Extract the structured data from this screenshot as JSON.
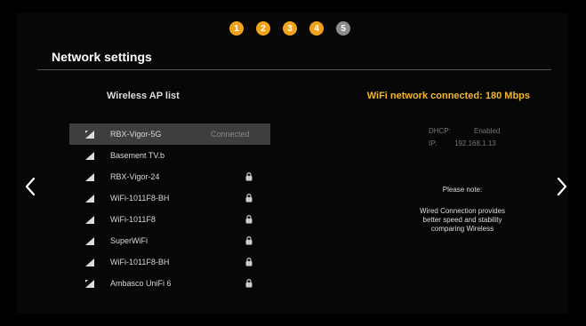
{
  "steps": [
    "1",
    "2",
    "3",
    "4",
    "5"
  ],
  "title": "Network settings",
  "wireless": {
    "header": "Wireless AP list",
    "items": [
      {
        "name": "RBX-Vigor-5G",
        "status": "Connected",
        "locked": false,
        "icon": "wifi-connected-icon"
      },
      {
        "name": "Basement TV.b",
        "status": "",
        "locked": false,
        "icon": "wifi-signal-icon"
      },
      {
        "name": "RBX-Vigor-24",
        "status": "",
        "locked": true,
        "icon": "wifi-signal-icon"
      },
      {
        "name": "WiFi-1011F8-BH",
        "status": "",
        "locked": true,
        "icon": "wifi-signal-icon"
      },
      {
        "name": "WiFi-1011F8",
        "status": "",
        "locked": true,
        "icon": "wifi-signal-icon"
      },
      {
        "name": "SuperWiFi",
        "status": "",
        "locked": true,
        "icon": "wifi-signal-icon"
      },
      {
        "name": "WiFi-1011F8-BH",
        "status": "",
        "locked": true,
        "icon": "wifi-signal-icon"
      },
      {
        "name": "Ambasco UniFi 6",
        "status": "",
        "locked": true,
        "icon": "wifi-connected-icon"
      }
    ]
  },
  "status": {
    "header": "WiFi network connected: 180 Mbps",
    "dhcp_label": "DHCP:",
    "dhcp_value": "Enabled",
    "ip_label": "IP:",
    "ip_value": "192.168.1.13",
    "note_title": "Please note:",
    "note_line1": "Wired Connection provides",
    "note_line2": "better speed and stability",
    "note_line3": "comparing Wireless"
  },
  "colors": {
    "accent": "#f2a31b",
    "current_step": "#8c8c8c",
    "selected_row": "#3e3e3e"
  }
}
